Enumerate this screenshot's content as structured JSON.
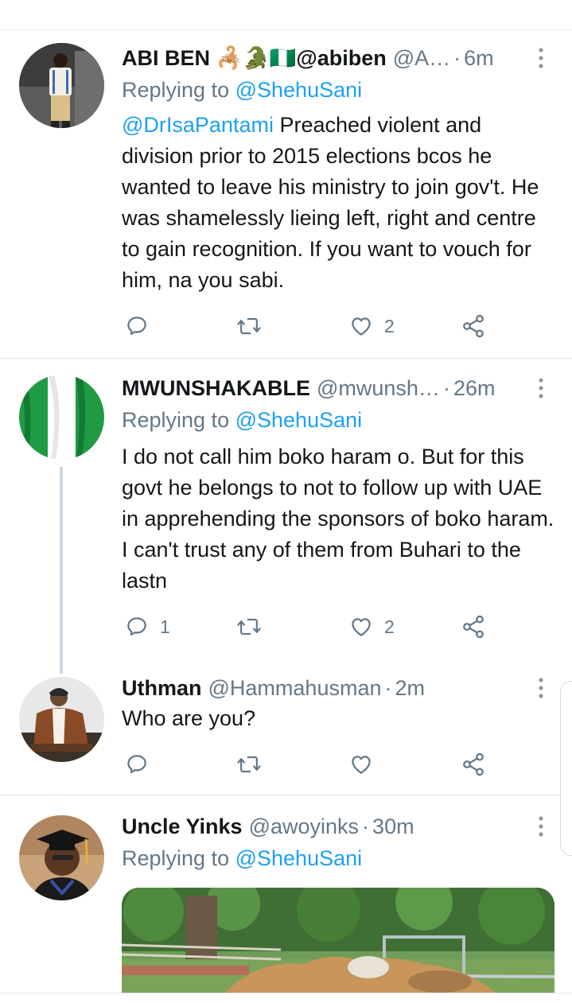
{
  "tweets": [
    {
      "name": "ABI BEN 🦂🐊🇳🇬@abiben",
      "handle": "@A…",
      "time": "6m",
      "reply_prefix": "Replying to",
      "reply_to": "@ShehuSani",
      "mention": "@DrIsaPantami",
      "text": " Preached violent and division prior to 2015 elections bcos he wanted to leave his ministry to join gov't. He was shamelessly lieing left, right and centre to gain recognition. If you want to vouch for him, na you sabi.",
      "reply_count": "",
      "retweet_count": "",
      "like_count": "2"
    },
    {
      "name": "MWUNSHAKABLE",
      "handle": "@mwunsh…",
      "time": "26m",
      "reply_prefix": "Replying to",
      "reply_to": "@ShehuSani",
      "text": "I do not call him boko haram o. But for this govt he belongs to not to follow up with UAE in apprehending the sponsors of boko haram. I can't trust any of them from Buhari to the lastn",
      "reply_count": "1",
      "retweet_count": "",
      "like_count": "2"
    },
    {
      "name": "Uthman",
      "handle": "@Hammahusman",
      "time": "2m",
      "text": "Who are you?",
      "reply_count": "",
      "retweet_count": "",
      "like_count": ""
    },
    {
      "name": "Uncle Yinks",
      "handle": "@awoyinks",
      "time": "30m",
      "reply_prefix": "Replying to",
      "reply_to": "@ShehuSani"
    }
  ],
  "icons": {
    "reply": "reply-icon",
    "retweet": "retweet-icon",
    "like": "heart-icon",
    "share": "share-icon",
    "more": "more-vertical-icon"
  },
  "colors": {
    "link": "#1da1f2",
    "muted": "#657786",
    "text": "#14171a",
    "divider": "#dfe5ea"
  }
}
